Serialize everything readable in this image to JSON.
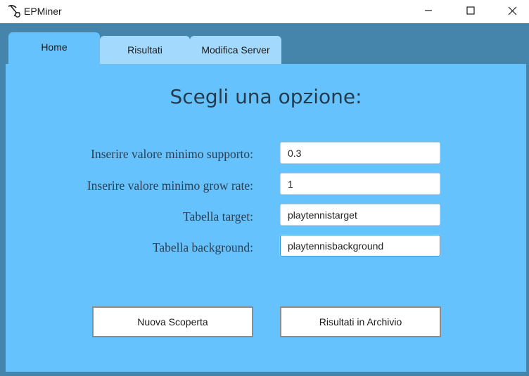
{
  "window": {
    "title": "EPMiner",
    "app_icon": "pickaxe-miner-icon",
    "controls": [
      "minimize-icon",
      "maximize-icon",
      "close-icon"
    ]
  },
  "tabs": [
    {
      "label": "Home",
      "active": true
    },
    {
      "label": "Risultati",
      "active": false
    },
    {
      "label": "Modifica Server",
      "active": false
    }
  ],
  "home": {
    "heading": "Scegli una opzione:",
    "fields": [
      {
        "label": "Inserire valore minimo supporto:",
        "value": "0.3"
      },
      {
        "label": "Inserire valore minimo grow rate:",
        "value": "1"
      },
      {
        "label": "Tabella target:",
        "value": "playtennistarget"
      },
      {
        "label": "Tabella background:",
        "value": "playtennisbackground",
        "focused": true
      }
    ],
    "buttons": {
      "new_discovery": "Nuova Scoperta",
      "archive_results": "Risultati in Archivio"
    }
  },
  "colors": {
    "window_bg": "#4584ab",
    "tab_active": "#66c2fc",
    "tab_inactive": "#a3d9fd",
    "content_bg": "#66c2fc",
    "input_focus_border": "#2f8fd8"
  }
}
